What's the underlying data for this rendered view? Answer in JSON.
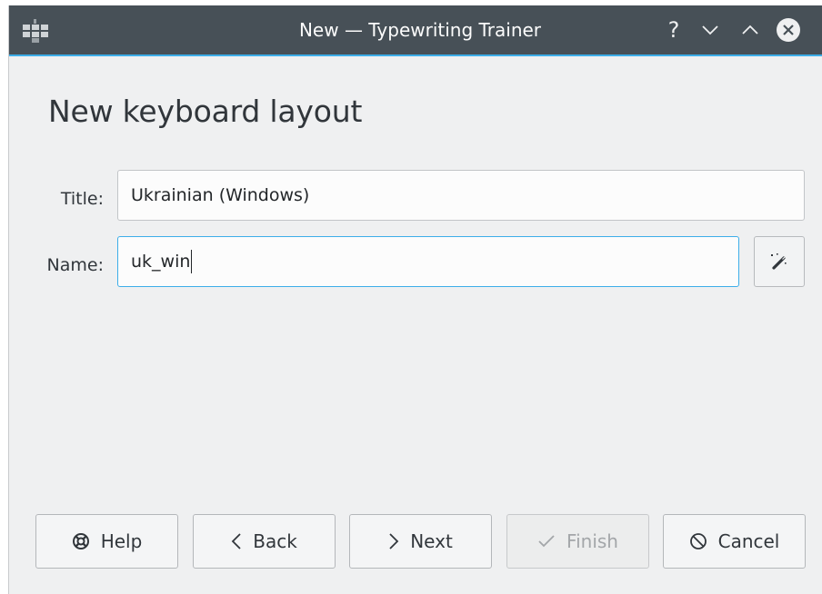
{
  "window": {
    "title": "New — Typewriting Trainer",
    "controls": {
      "help": "?",
      "minimize": "chevron-down-icon",
      "maximize": "chevron-up-icon",
      "close": "close-icon"
    },
    "accent_color": "#3daee9",
    "titlebar_color": "#475057"
  },
  "page": {
    "heading": "New keyboard layout"
  },
  "form": {
    "title_label": "Title:",
    "title_value": "Ukrainian (Windows)",
    "name_label": "Name:",
    "name_value": "uk_win",
    "generate_icon": "magic-wand-icon"
  },
  "buttons": {
    "help": "Help",
    "back": "Back",
    "next": "Next",
    "finish": "Finish",
    "cancel": "Cancel"
  }
}
